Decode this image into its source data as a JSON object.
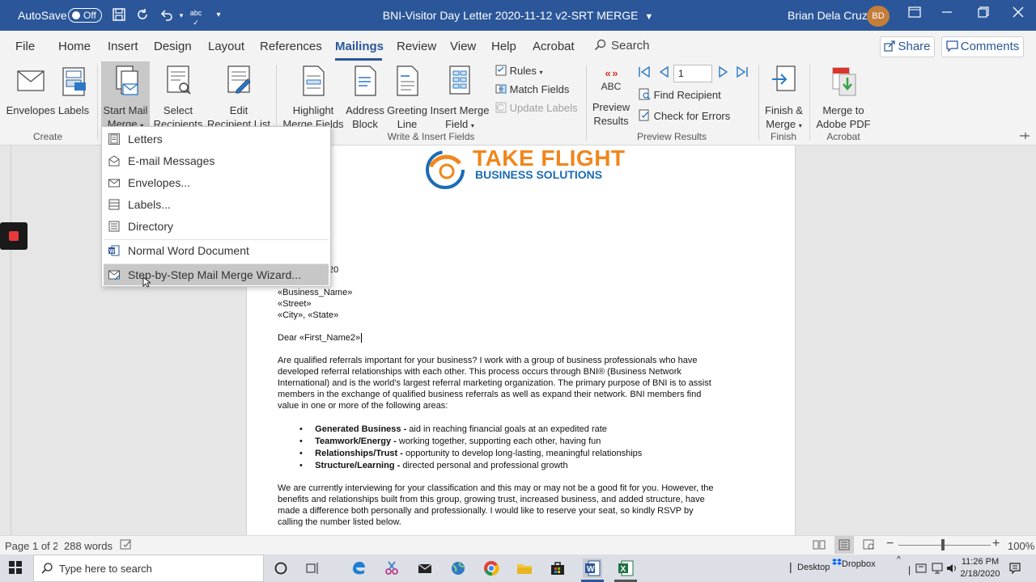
{
  "titlebar": {
    "autosave_label": "AutoSave",
    "autosave_state": "Off",
    "document_title": "BNI-Visitor Day Letter 2020-11-12 v2-SRT MERGE",
    "user_name": "Brian Dela Cruz",
    "user_initials": "BD"
  },
  "tabs": [
    "File",
    "Home",
    "Insert",
    "Design",
    "Layout",
    "References",
    "Mailings",
    "Review",
    "View",
    "Help",
    "Acrobat"
  ],
  "search_label": "Search",
  "share_label": "Share",
  "comments_label": "Comments",
  "ribbon": {
    "create": {
      "envelopes": "Envelopes",
      "labels": "Labels",
      "group": "Create"
    },
    "start": {
      "start_line1": "Start Mail",
      "start_line2": "Merge",
      "select_line1": "Select",
      "select_line2": "Recipients",
      "edit_line1": "Edit",
      "edit_line2": "Recipient List"
    },
    "write": {
      "highlight_line1": "Highlight",
      "highlight_line2": "Merge Fields",
      "address_line1": "Address",
      "address_line2": "Block",
      "greeting_line1": "Greeting",
      "greeting_line2": "Line",
      "insert_line1": "Insert Merge",
      "insert_line2": "Field",
      "rules": "Rules",
      "match_fields": "Match Fields",
      "update_labels": "Update Labels",
      "group": "Write & Insert Fields"
    },
    "preview": {
      "abc": "ABC",
      "preview_line1": "Preview",
      "preview_line2": "Results",
      "record_value": "1",
      "find_recipient": "Find Recipient",
      "check_errors": "Check for Errors",
      "group": "Preview Results"
    },
    "finish": {
      "finish_line1": "Finish &",
      "finish_line2": "Merge",
      "group": "Finish"
    },
    "acrobat": {
      "merge_line1": "Merge to",
      "merge_line2": "Adobe PDF",
      "group": "Acrobat"
    }
  },
  "dropdown": {
    "items": [
      {
        "label": "Letters"
      },
      {
        "label": "E-mail Messages"
      },
      {
        "label": "Envelopes..."
      },
      {
        "label": "Labels..."
      },
      {
        "label": "Directory"
      },
      {
        "label": "Normal Word Document"
      },
      {
        "label": "Step-by-Step Mail Merge Wizard..."
      }
    ]
  },
  "document": {
    "logo_line1": "TAKE FLIGHT",
    "logo_line2": "BUSINESS SOLUTIONS",
    "date_fragment": "20",
    "business_name": "«Business_Name»",
    "street": "«Street»",
    "city_state": "«City», «State»",
    "salutation": "Dear «First_Name2»",
    "para1": [
      "Are qualified referrals important for your business? I work with a group of business professionals who have",
      "developed referral relationships with each other. This process occurs through BNI® (Business Network",
      "International) and is the world’s largest referral marketing organization. The primary purpose of BNI is to assist",
      "members in the exchange of qualified business referrals as well as expand their network. BNI members find",
      "value in one or more of the following areas:"
    ],
    "bullets": [
      {
        "bold": "Generated Business -",
        "text": " aid in reaching financial goals at an expedited rate"
      },
      {
        "bold": "Teamwork/Energy -",
        "text": " working together, supporting each other, having fun"
      },
      {
        "bold": "Relationships/Trust -",
        "text": " opportunity to develop long-lasting, meaningful relationships"
      },
      {
        "bold": "Structure/Learning -",
        "text": " directed personal and professional growth"
      }
    ],
    "para2": [
      "We are currently interviewing for your classification and this may or may not be a good fit for you. However, the",
      "benefits and relationships built from this group, growing trust, increased business, and added structure, have",
      "made a difference both personally and professionally. I would like to reserve your seat, so kindly RSVP by",
      "calling the number listed below."
    ]
  },
  "statusbar": {
    "page": "Page 1 of 2",
    "words": "288 words",
    "zoom": "100%"
  },
  "taskbar": {
    "search_placeholder": "Type here to search",
    "desktop": "Desktop",
    "dropbox": "Dropbox",
    "time": "11:26 PM",
    "date": "2/18/2020"
  }
}
